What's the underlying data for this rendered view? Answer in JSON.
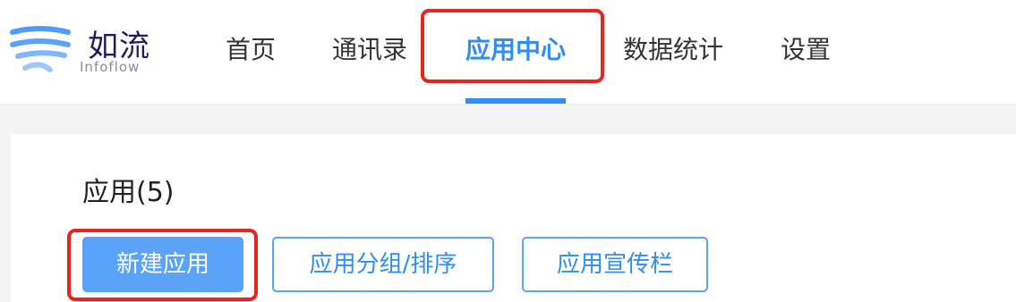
{
  "brand": {
    "name": "如流",
    "sub": "Infoflow",
    "color": "#1f1d5c",
    "mark_color": "#5aa3f8"
  },
  "nav": {
    "items": [
      {
        "label": "首页",
        "active": false
      },
      {
        "label": "通讯录",
        "active": false
      },
      {
        "label": "应用中心",
        "active": true
      },
      {
        "label": "数据统计",
        "active": false
      },
      {
        "label": "设置",
        "active": false
      }
    ],
    "active_color": "#2f8ef5"
  },
  "main": {
    "title": "应用(5)",
    "buttons": {
      "new_app": "新建应用",
      "group_sort": "应用分组/排序",
      "promo_banner": "应用宣传栏"
    }
  },
  "annotations": {
    "highlight_color": "#e8251d"
  }
}
